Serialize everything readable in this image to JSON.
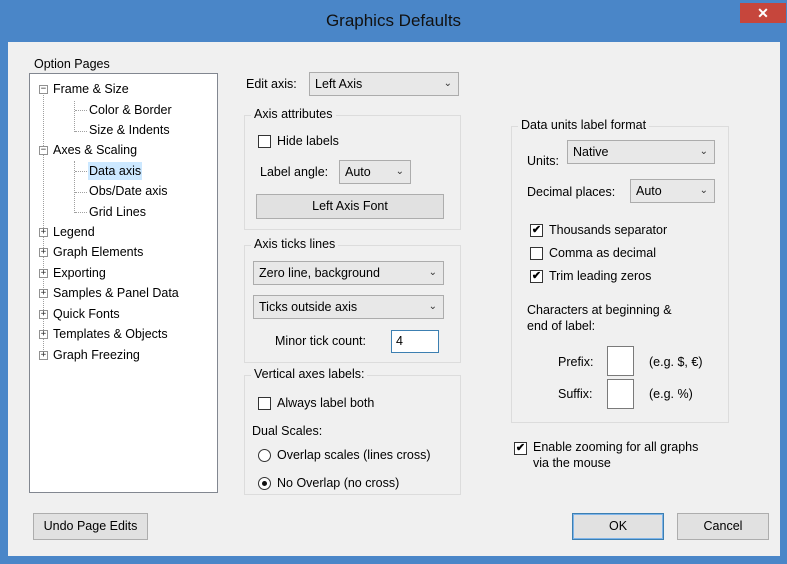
{
  "window": {
    "title": "Graphics Defaults",
    "close_label": "✕"
  },
  "option_pages": {
    "label": "Option Pages",
    "tree": [
      {
        "label": "Frame & Size",
        "toggle": "−"
      },
      {
        "label": "Color & Border"
      },
      {
        "label": "Size & Indents"
      },
      {
        "label": "Axes & Scaling",
        "toggle": "−"
      },
      {
        "label": "Data axis"
      },
      {
        "label": "Obs/Date axis"
      },
      {
        "label": "Grid Lines"
      },
      {
        "label": "Legend",
        "toggle": "+"
      },
      {
        "label": "Graph Elements",
        "toggle": "+"
      },
      {
        "label": "Exporting",
        "toggle": "+"
      },
      {
        "label": "Samples & Panel Data",
        "toggle": "+"
      },
      {
        "label": "Quick Fonts",
        "toggle": "+"
      },
      {
        "label": "Templates & Objects",
        "toggle": "+"
      },
      {
        "label": "Graph Freezing",
        "toggle": "+"
      }
    ]
  },
  "edit_axis": {
    "label": "Edit axis:",
    "value": "Left Axis"
  },
  "axis_attributes": {
    "title": "Axis attributes",
    "hide_labels": "Hide labels",
    "label_angle_label": "Label angle:",
    "label_angle_value": "Auto",
    "font_button": "Left Axis Font"
  },
  "axis_ticks": {
    "title": "Axis ticks  lines",
    "zero_line_value": "Zero line, background",
    "ticks_value": "Ticks outside axis",
    "minor_tick_label": "Minor tick count:",
    "minor_tick_value": "4"
  },
  "vertical_axes": {
    "title": "Vertical axes labels:",
    "always_label_both": "Always label both",
    "dual_scales_label": "Dual Scales:",
    "overlap": "Overlap  scales (lines cross)",
    "no_overlap": "No Overlap (no cross)"
  },
  "data_units": {
    "title": "Data units  label format",
    "units_label": "Units:",
    "units_value": "Native",
    "decimal_label": "Decimal places:",
    "decimal_value": "Auto",
    "thousands": "Thousands separator",
    "comma_decimal": "Comma as decimal",
    "trim_zeros": "Trim leading zeros",
    "characters_label_1": "Characters at beginning &",
    "characters_label_2": "end of label:",
    "prefix_label": "Prefix:",
    "prefix_hint": "(e.g. $, €)",
    "suffix_label": "Suffix:",
    "suffix_hint": "(e.g. %)"
  },
  "zoom": {
    "line1": "Enable zooming for all graphs",
    "line2": "via the mouse"
  },
  "buttons": {
    "undo": "Undo Page Edits",
    "ok": "OK",
    "cancel": "Cancel"
  },
  "check_mark": "✔",
  "dropdown_arrow": "⌄"
}
